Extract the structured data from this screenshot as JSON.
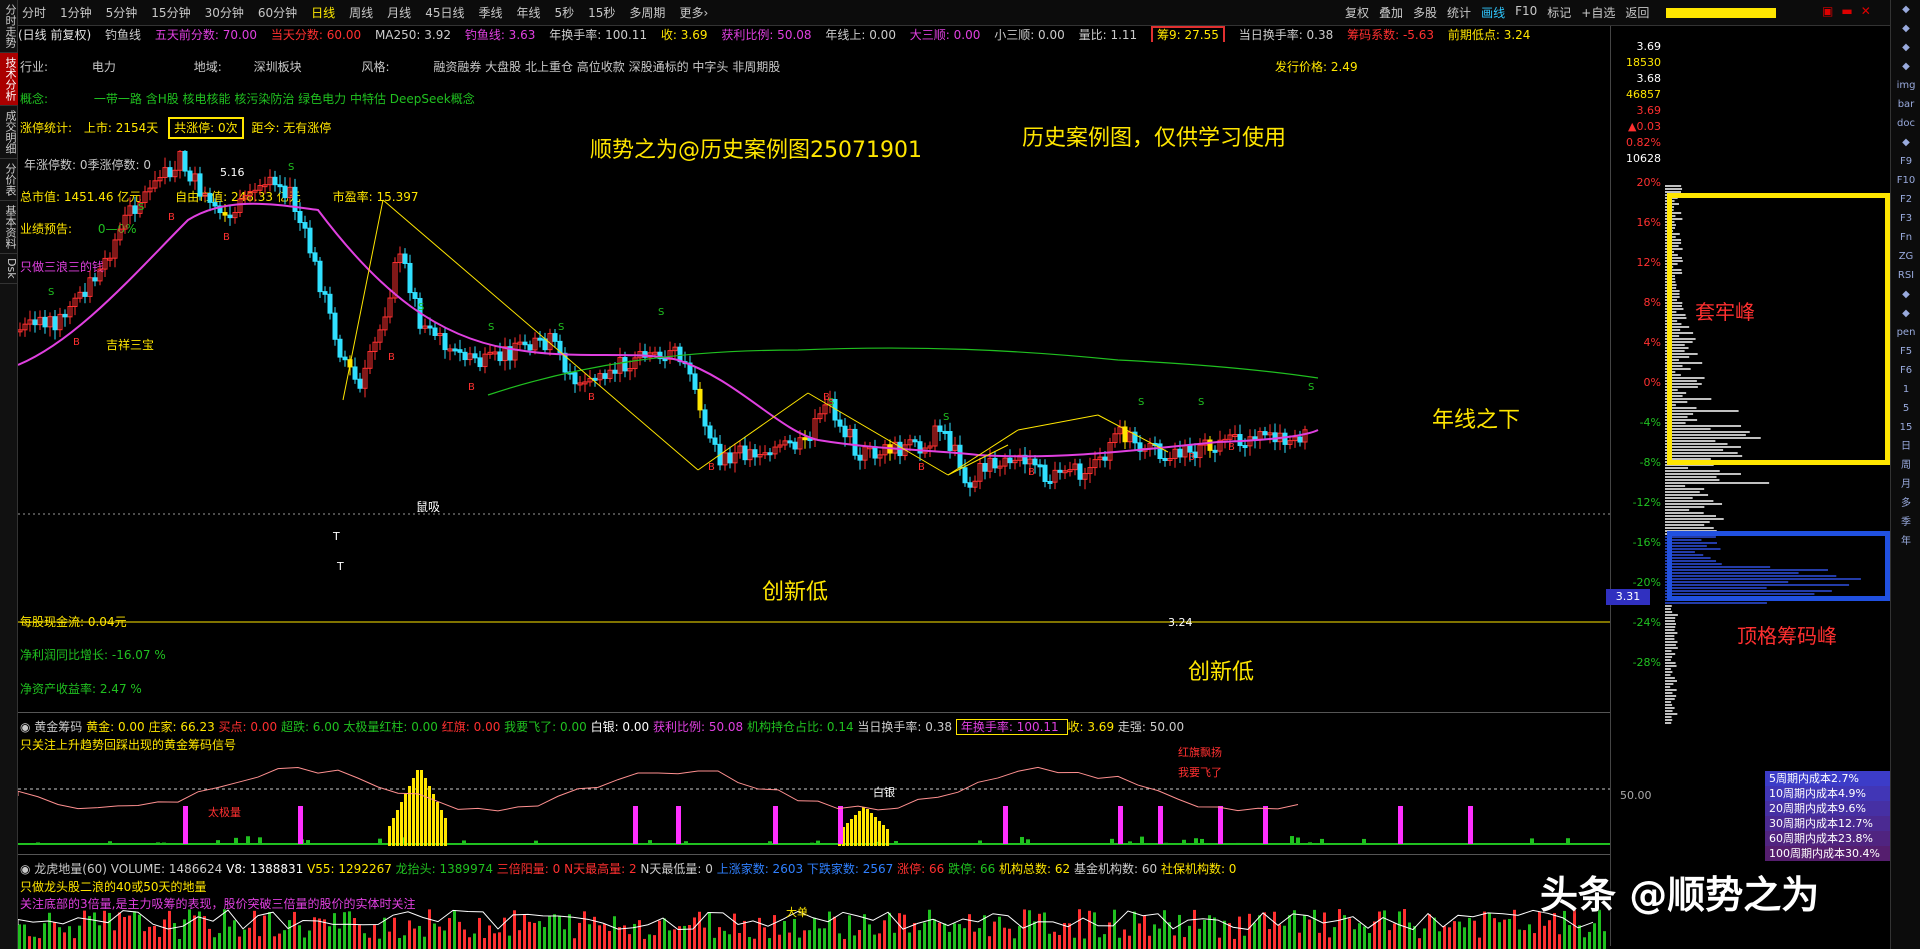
{
  "periods": [
    "分时",
    "1分钟",
    "5分钟",
    "15分钟",
    "30分钟",
    "60分钟",
    "日线",
    "周线",
    "月线",
    "45日线",
    "季线",
    "年线",
    "5秒",
    "15秒",
    "多周期",
    "更多›"
  ],
  "period_active": "日线",
  "right_tools": [
    "复权",
    "叠加",
    "多股",
    "统计",
    "画线",
    "F10",
    "标记",
    "+自选",
    "返回"
  ],
  "right_tool_active": "画线",
  "left_tabs": [
    "分时走势",
    "技术分析",
    "成交明细",
    "分价表",
    "基本资料",
    "Dsk"
  ],
  "left_tab_active": "技术分析",
  "indicator_bar": {
    "title": "(日线 前复权)",
    "gold_fish": "钓鱼线",
    "five_day_prev": "五天前分数: 70.00",
    "today_score": "当天分数: 60.00",
    "ma250": "MA250: 3.92",
    "fish_line": "钓鱼线: 3.63",
    "annual_turnover": "年换手率: 100.11",
    "close": "收: 3.69",
    "profit_ratio": "获利比例: 50.08",
    "year_up": "年线上: 0.00",
    "big_three": "大三顺: 0.00",
    "small_three": "小三顺: 0.00",
    "vol_ratio": "量比: 1.11",
    "chip9": "筹9: 27.55",
    "today_turnover": "当日换手率: 0.38",
    "chip_coef": "筹码系数: -5.63",
    "prev_low": "前期低点: 3.24"
  },
  "info": {
    "industry_label": "行业:",
    "industry": "电力",
    "region_label": "地域:",
    "region": "深圳板块",
    "style_label": "风格:",
    "style": "融资融券 大盘股 北上重仓 高位收款 深股通标的 中字头 非周期股",
    "issue_price": "发行价格: 2.49",
    "concept_label": "概念:",
    "concept": "一带一路 含H股 核电核能 核污染防治 绿色电力 中特估 DeepSeek概念",
    "limit_label": "涨停统计:",
    "listed": "上市: 2154天",
    "total_limit": "共涨停: 0次",
    "since": "距今: 无有涨停",
    "year_limit": "年涨停数: 0季涨停数: 0",
    "market_cap": "总市值: 1451.46 亿元",
    "float_cap": "自由市值: 248.33 亿元",
    "pe": "市盈率: 15.397",
    "forecast_label": "业绩预告:",
    "forecast": "0—0%",
    "note1": "只做三浪三的钱",
    "eps": "每股现金流: 0.04元",
    "net_profit": "净利润同比增长: -16.07 %",
    "roe": "净资产收益率: 2.47 %"
  },
  "annotations": {
    "title_text": "顺势之为@历史案例图25071901",
    "disclaimer": "历史案例图，仅供学习使用",
    "new_low1": "创新低",
    "new_low2": "创新低",
    "below_year": "年线之下",
    "trap_peak": "套牢峰",
    "top_chip_peak": "顶格筹码峰",
    "jixiang": "吉祥三宝",
    "dixi": "鼠吸",
    "high_label": "5.16",
    "low_label": "3.24",
    "price_tag": "3.31"
  },
  "right_axis": {
    "top": [
      "3.69",
      "18530",
      "3.68",
      "46857",
      "3.69",
      "▲0.03",
      "0.82%",
      "10628"
    ],
    "pct": [
      "20%",
      "16%",
      "12%",
      "8%",
      "4%",
      "0%",
      "-4%",
      "-8%",
      "-12%",
      "-16%",
      "-20%",
      "-24%",
      "-28%"
    ]
  },
  "golden_panel": {
    "header": "黄金筹码",
    "items": [
      "黄金: 0.00",
      "庄家: 66.23",
      "买点: 0.00",
      "超跌: 6.00",
      "太极量红柱: 0.00",
      "红旗: 0.00",
      "我要飞了: 0.00",
      "白银: 0.00",
      "获利比例: 50.08",
      "机构持仓占比: 0.14",
      "当日换手率: 0.38",
      "年换手率: 100.11",
      "收: 3.69",
      "走强: 50.00"
    ],
    "subtitle": "只关注上升趋势回踩出现的黄金筹码信号",
    "label_50": "50.00",
    "marks": [
      "太极量",
      "红旗飘扬",
      "我要飞了",
      "白银"
    ]
  },
  "dragon_panel": {
    "header": "龙虎地量(60)",
    "items": [
      "VOLUME: 1486624",
      "V8: 1388831",
      "V55: 1292267",
      "龙抬头: 1389974",
      "三倍阳量: 0",
      "N天最高量: 2",
      "N天最低量: 0",
      "上涨家数: 2603",
      "下跌家数: 2567",
      "涨停: 66",
      "跌停: 66",
      "机构总数: 62",
      "基金机构数: 60",
      "社保机构数: 0"
    ],
    "line1": "只做龙头股二浪的40或50天的地量",
    "line2": "关注底部的3倍量,是主力吸筹的表现，股价突破三倍量的股价的实体时关注",
    "big": "大单"
  },
  "chip_costs": [
    "5周期内成本2.7%",
    "10周期内成本4.9%",
    "20周期内成本9.6%",
    "30周期内成本12.7%",
    "60周期内成本23.8%",
    "100周期内成本30.4%"
  ],
  "watermark": "头条 @顺势之为",
  "colors": {
    "up": "#ff3030",
    "down": "#30e0ff",
    "ma": "#e040e0",
    "year": "#20c020",
    "yellow": "#ffe600",
    "box_blue": "#2050e0"
  },
  "right_icons": [
    "up-arrow",
    "down-arrow",
    "book",
    "grid",
    "img",
    "bar",
    "doc",
    "chart",
    "F9",
    "F10",
    "F2",
    "F3",
    "Fn",
    "ZG",
    "RSI",
    "diamond",
    "move",
    "pen",
    "F5",
    "F6",
    "1",
    "5",
    "15",
    "日",
    "周",
    "月",
    "多",
    "季",
    "年"
  ]
}
